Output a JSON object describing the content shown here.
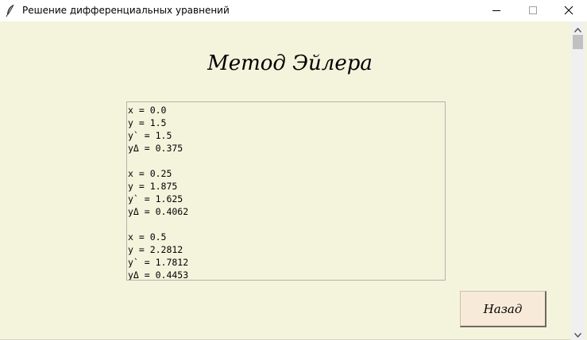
{
  "window": {
    "title": "Решение дифференциальных уравнений",
    "icons": {
      "app": "feather-icon",
      "minimize": "minimize-icon",
      "maximize": "maximize-icon",
      "close": "close-icon"
    }
  },
  "main": {
    "heading": "Метод Эйлера",
    "output_lines": [
      "x = 0.0",
      "y = 1.5",
      "y` = 1.5",
      "yΔ = 0.375",
      "",
      "x = 0.25",
      "y = 1.875",
      "y` = 1.625",
      "yΔ = 0.4062",
      "",
      "x = 0.5",
      "y = 2.2812",
      "y` = 1.7812",
      "yΔ = 0.4453"
    ],
    "back_button": "Назад"
  },
  "colors": {
    "background": "#f4f3dc",
    "button_background": "#f8ead8"
  }
}
